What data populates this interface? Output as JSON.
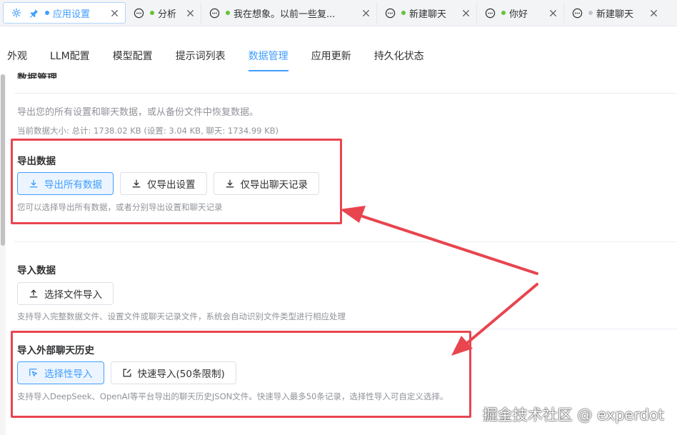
{
  "tabs": [
    {
      "title": "应用设置",
      "active": true,
      "icon": "gear-icon",
      "pinned": true
    },
    {
      "title": "分析",
      "active": false,
      "icon": "chat-bubble-icon"
    },
    {
      "title": "我在想象。以前一些复...",
      "active": false,
      "icon": "chat-bubble-icon"
    },
    {
      "title": "新建聊天",
      "active": false,
      "icon": "chat-bubble-icon"
    },
    {
      "title": "你好",
      "active": false,
      "icon": "chat-bubble-icon"
    },
    {
      "title": "新建聊天",
      "active": false,
      "icon": "chat-bubble-icon"
    }
  ],
  "nav": {
    "items": [
      "外观",
      "LLM配置",
      "模型配置",
      "提示词列表",
      "数据管理",
      "应用更新",
      "持久化状态"
    ],
    "active_index": 4
  },
  "section": {
    "title": "数据管理",
    "description": "导出您的所有设置和聊天数据，或从备份文件中恢复数据。",
    "size_info": "当前数据大小: 总计: 1738.02 KB (设置: 3.04 KB, 聊天: 1734.99 KB)"
  },
  "export": {
    "title": "导出数据",
    "buttons": [
      "导出所有数据",
      "仅导出设置",
      "仅导出聊天记录"
    ],
    "hint": "您可以选择导出所有数据，或者分别导出设置和聊天记录"
  },
  "import": {
    "title": "导入数据",
    "button": "选择文件导入",
    "hint": "支持导入完整数据文件、设置文件或聊天记录文件，系统会自动识别文件类型进行相应处理"
  },
  "external": {
    "title": "导入外部聊天历史",
    "buttons": [
      "选择性导入",
      "快速导入(50条限制)"
    ],
    "hint": "支持导入DeepSeek、OpenAI等平台导出的聊天历史JSON文件。快速导入最多50条记录，选择性导入可自定义选择。"
  },
  "watermark": "掘金技术社区 @ experdot",
  "colors": {
    "accent": "#409eff",
    "annotation": "#e8454f",
    "success_dot": "#67c23a"
  }
}
